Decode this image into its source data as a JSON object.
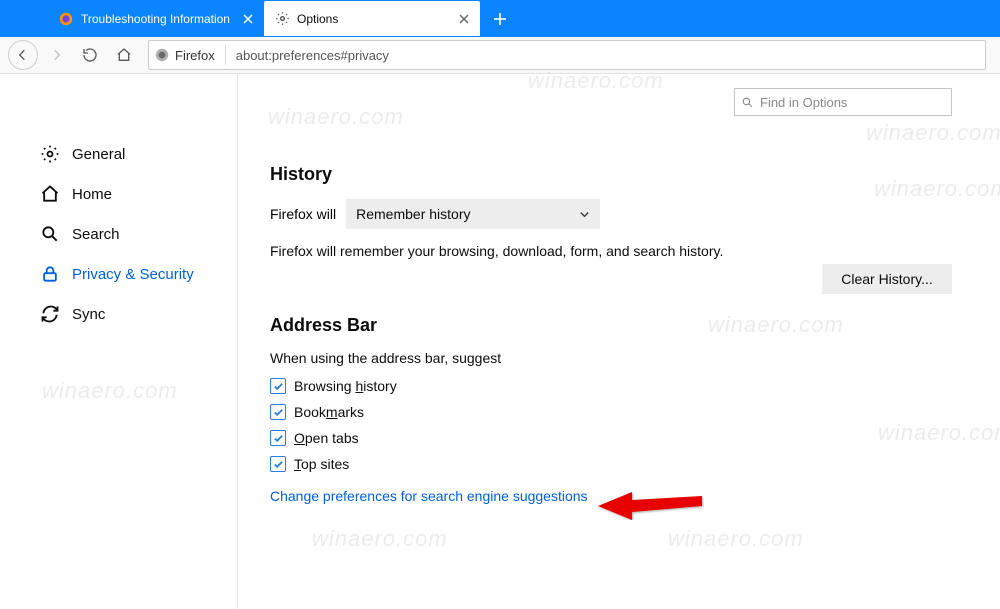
{
  "tabs": {
    "inactive_label": "Troubleshooting Information",
    "active_label": "Options"
  },
  "urlbar": {
    "identity_label": "Firefox",
    "url": "about:preferences#privacy"
  },
  "find": {
    "placeholder": "Find in Options"
  },
  "sidebar": {
    "general": "General",
    "home": "Home",
    "search": "Search",
    "privacy": "Privacy & Security",
    "sync": "Sync"
  },
  "history": {
    "heading": "History",
    "label": "Firefox will",
    "dropdown_value": "Remember history",
    "desc": "Firefox will remember your browsing, download, form, and search history.",
    "clear_button": "Clear History..."
  },
  "addressbar": {
    "heading": "Address Bar",
    "subhead": "When using the address bar, suggest",
    "opt_history_pre": "Browsing ",
    "opt_history_key": "h",
    "opt_history_post": "istory",
    "opt_bookmarks_pre": "Book",
    "opt_bookmarks_key": "m",
    "opt_bookmarks_post": "arks",
    "opt_opentabs_pre": "",
    "opt_opentabs_key": "O",
    "opt_opentabs_post": "pen tabs",
    "opt_topsites_pre": "",
    "opt_topsites_key": "T",
    "opt_topsites_post": "op sites",
    "link": "Change preferences for search engine suggestions"
  },
  "watermark": "winaero.com"
}
